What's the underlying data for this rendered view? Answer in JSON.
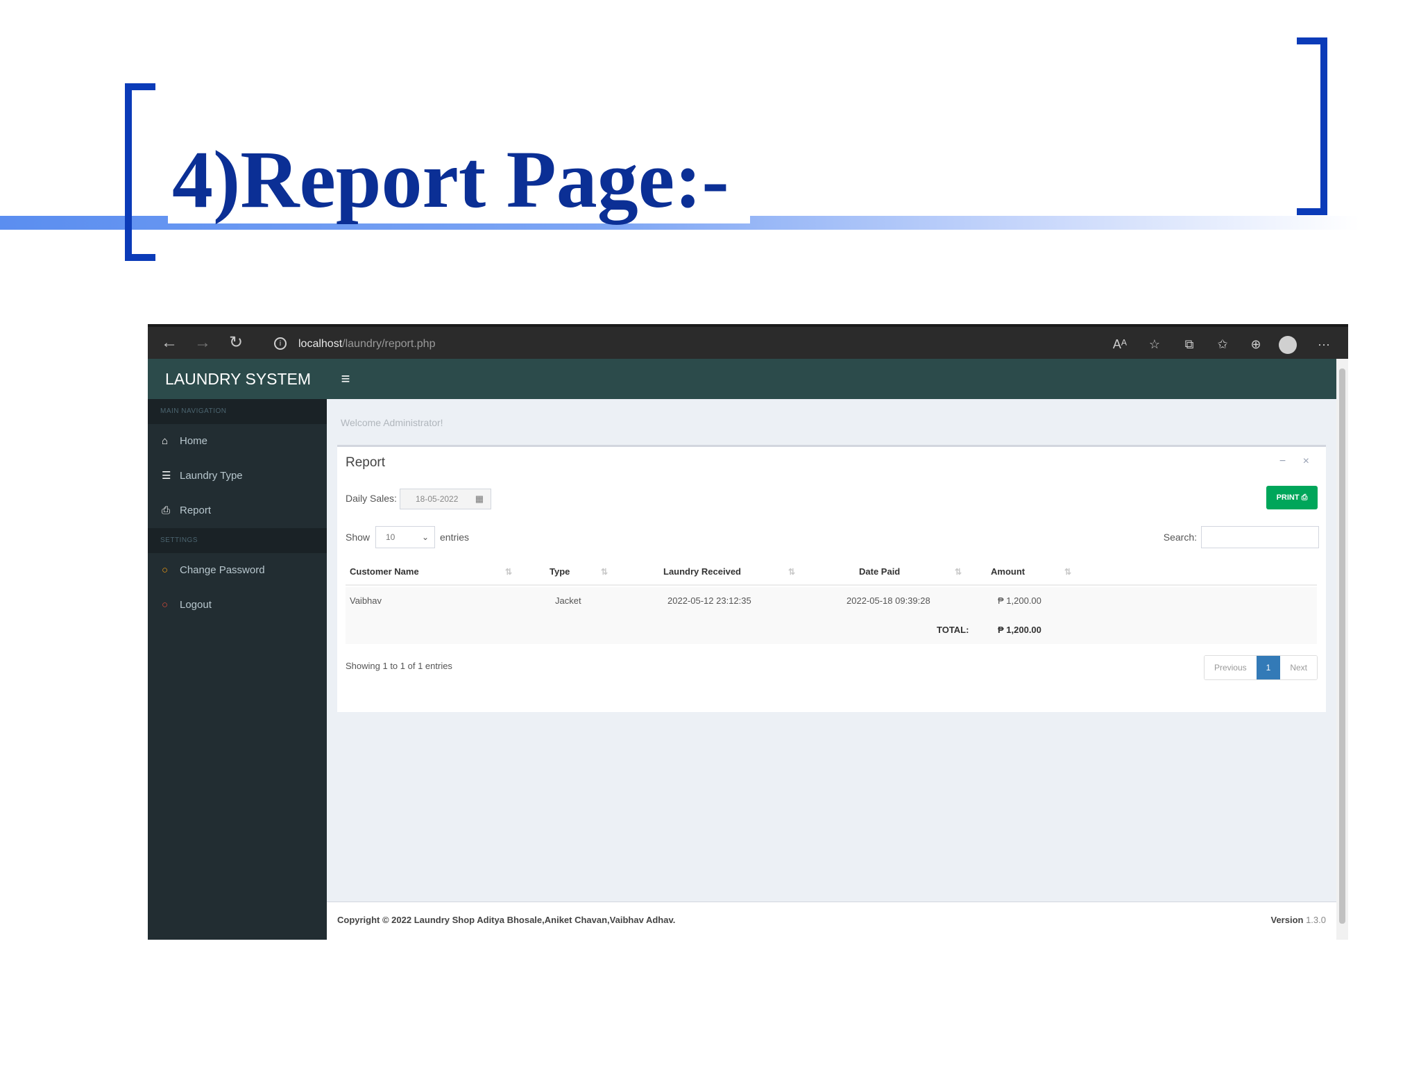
{
  "slide": {
    "title": "4)Report Page:-"
  },
  "browser": {
    "url_host": "localhost",
    "url_path": "/laundry/report.php",
    "back_icon": "←",
    "forward_icon": "→",
    "reload_icon": "↻",
    "info_icon": "i",
    "read_aloud_icon": "Aᴬ",
    "favorite_icon": "☆",
    "split_icon": "⧉",
    "favorites_icon": "✩",
    "collections_icon": "⊕",
    "more_icon": "···"
  },
  "app": {
    "logo": "LAUNDRY SYSTEM",
    "menu_icon": "≡"
  },
  "sidebar": {
    "main_header": "MAIN NAVIGATION",
    "settings_header": "SETTINGS",
    "items": [
      {
        "label": "Home",
        "icon": "⌂"
      },
      {
        "label": "Laundry Type",
        "icon": "☰"
      },
      {
        "label": "Report",
        "icon": "⎙"
      }
    ],
    "settings_items": [
      {
        "label": "Change Password",
        "icon": "○"
      },
      {
        "label": "Logout",
        "icon": "○"
      }
    ]
  },
  "content": {
    "welcome": "Welcome Administrator!",
    "box_title": "Report",
    "box_tools": "− ×",
    "daily_sales_label": "Daily Sales:",
    "date_value": "18-05-2022",
    "calendar_icon": "▦",
    "print_label": "PRINT ⎙",
    "show_label": "Show",
    "page_length": "10",
    "entries_label": "entries",
    "search_label": "Search:",
    "sort_icon": "⇅",
    "table": {
      "headers": [
        "Customer Name",
        "Type",
        "Laundry Received",
        "Date Paid",
        "Amount"
      ],
      "rows": [
        [
          "Vaibhav",
          "Jacket",
          "2022-05-12 23:12:35",
          "2022-05-18 09:39:28",
          "₱ 1,200.00"
        ]
      ],
      "total_label": "TOTAL:",
      "total_value": "₱ 1,200.00"
    },
    "info": "Showing 1 to 1 of 1 entries",
    "pagination": {
      "previous": "Previous",
      "current": "1",
      "next": "Next"
    }
  },
  "footer": {
    "copyright": "Copyright © 2022 Laundry Shop Aditya Bhosale,Aniket Chavan,Vaibhav Adhav.",
    "version_label": "Version",
    "version": "1.3.0"
  },
  "colors": {
    "title": "#0b2f95",
    "bracket": "#0b3bb8",
    "header": "#2c4b4b",
    "sidebar": "#222d32",
    "print": "#00a65a",
    "page_active": "#337ab7"
  }
}
